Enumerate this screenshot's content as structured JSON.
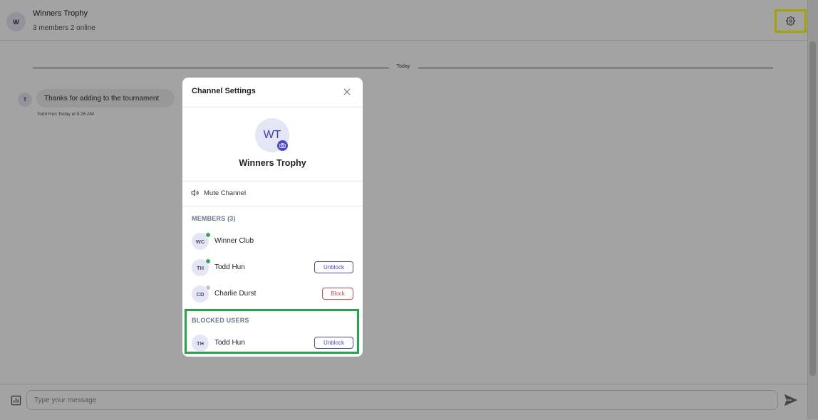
{
  "header": {
    "avatar_initial": "W",
    "title": "Winners Trophy",
    "subtitle": "3 members 2 online",
    "settings_icon": "gear-icon"
  },
  "chat": {
    "day_label": "Today",
    "messages": [
      {
        "avatar_initial": "T",
        "text": "Thanks for adding to the tournament",
        "meta": "Todd Hun Today at 6:26 AM"
      }
    ]
  },
  "composer": {
    "placeholder": "Type your message",
    "poll_icon": "poll-icon",
    "send_icon": "send-icon"
  },
  "modal": {
    "title": "Channel Settings",
    "close_icon": "close-icon",
    "channel_initials": "WT",
    "channel_name": "Winners Trophy",
    "mute_label": "Mute Channel",
    "members_heading": "MEMBERS (3)",
    "members": [
      {
        "initials": "WC",
        "name": "Winner Club",
        "status": "online",
        "action": ""
      },
      {
        "initials": "TH",
        "name": "Todd Hun",
        "status": "online",
        "action": "Unblock"
      },
      {
        "initials": "CD",
        "name": "Charlie Durst",
        "status": "offline",
        "action": "Block"
      }
    ],
    "blocked_heading": "BLOCKED USERS",
    "blocked": [
      {
        "initials": "TH",
        "name": "Todd Hun",
        "action": "Unblock"
      }
    ]
  },
  "colors": {
    "accent": "#4a49d1",
    "danger": "#e04848",
    "online": "#2bb24c",
    "offline": "#c4c4c4",
    "highlight_yellow": "#ffff00",
    "highlight_green": "#22a849"
  }
}
